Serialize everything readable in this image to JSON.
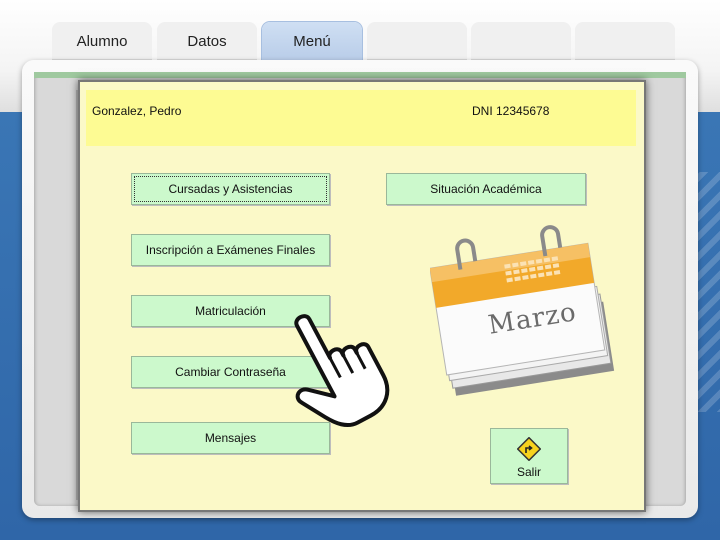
{
  "tabs": [
    {
      "label": "Alumno",
      "active": false
    },
    {
      "label": "Datos",
      "active": false
    },
    {
      "label": "Menú",
      "active": true
    },
    {
      "label": "",
      "active": false
    },
    {
      "label": "",
      "active": false
    },
    {
      "label": "",
      "active": false
    }
  ],
  "app": {
    "student_name": "Gonzalez, Pedro",
    "dni": "DNI 12345678",
    "buttons": {
      "cursadas": "Cursadas y Asistencias",
      "situacion": "Situación Académica",
      "inscripcion": "Inscripción a Exámenes Finales",
      "matriculacion": "Matriculación",
      "cambiar": "Cambiar Contraseña",
      "mensajes": "Mensajes",
      "salir": "Salir"
    },
    "calendar_month": "Marzo"
  },
  "colors": {
    "window_bg": "#fbf9c8",
    "header_bg": "#fdfb93",
    "button_bg": "#ccf9cc",
    "active_tab": "#c4d7ef",
    "band_blue": "#3370b0"
  },
  "icons": [
    "calendar-icon",
    "pointing-hand-cursor",
    "exit-sign-icon"
  ]
}
